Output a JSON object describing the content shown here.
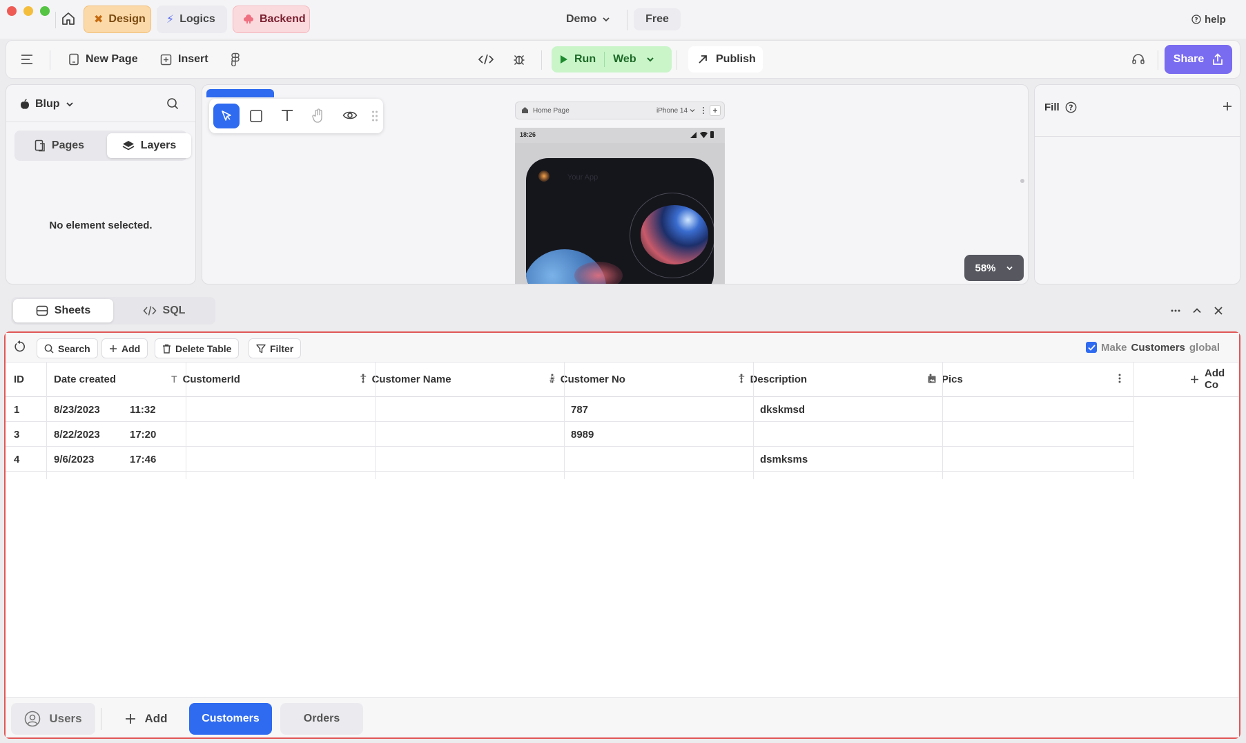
{
  "titlebar": {
    "tabs": {
      "design": "Design",
      "logics": "Logics",
      "backend": "Backend"
    },
    "project": "Demo",
    "plan": "Free",
    "help": "help"
  },
  "toolbar": {
    "new_page": "New Page",
    "insert": "Insert",
    "run": "Run",
    "target": "Web",
    "publish": "Publish",
    "share": "Share"
  },
  "left_panel": {
    "workspace": "Blup",
    "tabs": {
      "pages": "Pages",
      "layers": "Layers"
    },
    "empty_message": "No element selected."
  },
  "canvas": {
    "preview_page": "Home Page",
    "device": "iPhone 14",
    "status_time": "18:26",
    "app_title": "Your App",
    "zoom": "58%"
  },
  "right_panel": {
    "fill_label": "Fill"
  },
  "bottom_tabs": {
    "sheets": "Sheets",
    "sql": "SQL"
  },
  "sheet_toolbar": {
    "search": "Search",
    "add": "Add",
    "delete_table": "Delete Table",
    "filter": "Filter",
    "global_prefix": "Make",
    "global_table": "Customers",
    "global_suffix": "global",
    "global_checked": true
  },
  "table": {
    "columns": {
      "id": "ID",
      "date_created": "Date created",
      "customer_id": "CustomerId",
      "customer_name": "Customer Name",
      "customer_no": "Customer No",
      "description": "Description",
      "pics": "Pics",
      "add_column": "Add Co"
    },
    "rows": [
      {
        "id": "1",
        "date": "8/23/2023",
        "time": "11:32",
        "customer_id": "",
        "customer_name": "",
        "customer_no": "787",
        "description": "dkskmsd",
        "pics": ""
      },
      {
        "id": "3",
        "date": "8/22/2023",
        "time": "17:20",
        "customer_id": "",
        "customer_name": "",
        "customer_no": "8989",
        "description": "",
        "pics": ""
      },
      {
        "id": "4",
        "date": "9/6/2023",
        "time": "17:46",
        "customer_id": "",
        "customer_name": "",
        "customer_no": "",
        "description": "dsmksms",
        "pics": ""
      }
    ]
  },
  "tables_bar": {
    "users": "Users",
    "add": "Add",
    "customers": "Customers",
    "orders": "Orders"
  },
  "colors": {
    "accent_blue": "#2f6bf0",
    "share_purple": "#7a6cf0",
    "run_green": "#c9f5c9",
    "design_orange": "#fbd9a8",
    "backend_pink": "#fbdadd",
    "selection_red": "#e15656"
  }
}
